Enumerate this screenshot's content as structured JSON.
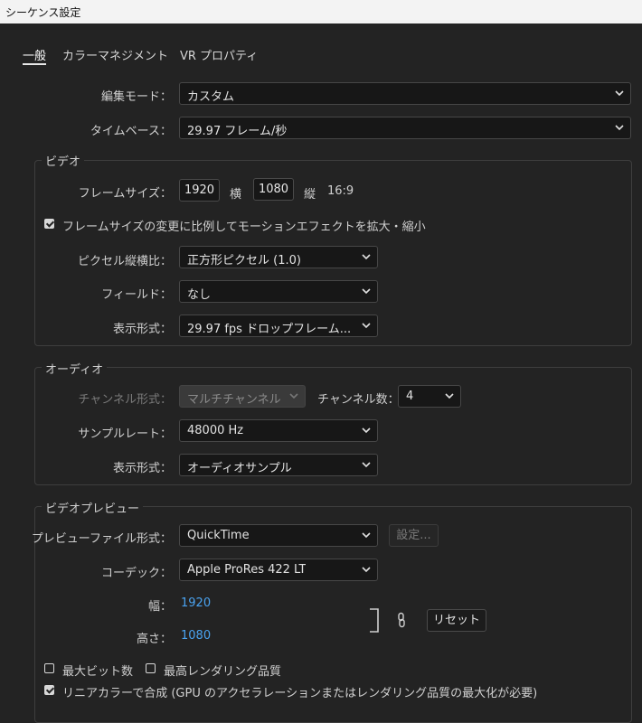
{
  "window": {
    "title": "シーケンス設定"
  },
  "tabs": [
    {
      "label": "一般",
      "active": true
    },
    {
      "label": "カラーマネジメント",
      "active": false
    },
    {
      "label": "VR プロパティ",
      "active": false
    }
  ],
  "general": {
    "edit_mode": {
      "label": "編集モード：",
      "value": "カスタム"
    },
    "timebase": {
      "label": "タイムベース：",
      "value": "29.97  フレーム/秒"
    }
  },
  "video": {
    "title": "ビデオ",
    "frame_size": {
      "label": "フレームサイズ：",
      "width": "1920",
      "width_unit": "横",
      "height": "1080",
      "height_unit": "縦",
      "ratio": "16:9"
    },
    "scale_checkbox": {
      "label": "フレームサイズの変更に比例してモーションエフェクトを拡大・縮小",
      "checked": true
    },
    "pixel_aspect": {
      "label": "ピクセル縦横比：",
      "value": "正方形ピクセル (1.0)"
    },
    "fields": {
      "label": "フィールド：",
      "value": "なし"
    },
    "display_format": {
      "label": "表示形式：",
      "value": "29.97 fps ドロップフレーム..."
    }
  },
  "audio": {
    "title": "オーディオ",
    "channel_format": {
      "label": "チャンネル形式：",
      "value": "マルチチャンネル"
    },
    "channel_count": {
      "label": "チャンネル数：",
      "value": "4"
    },
    "sample_rate": {
      "label": "サンプルレート：",
      "value": "48000 Hz"
    },
    "display_format": {
      "label": "表示形式：",
      "value": "オーディオサンプル"
    }
  },
  "preview": {
    "title": "ビデオプレビュー",
    "file_format": {
      "label": "プレビューファイル形式：",
      "value": "QuickTime",
      "settings_label": "設定..."
    },
    "codec": {
      "label": "コーデック：",
      "value": "Apple ProRes 422 LT"
    },
    "width": {
      "label": "幅：",
      "value": "1920"
    },
    "height": {
      "label": "高さ：",
      "value": "1080"
    },
    "reset_label": "リセット"
  },
  "options": {
    "max_bit_depth": {
      "label": "最大ビット数",
      "checked": false
    },
    "max_render_quality": {
      "label": "最高レンダリング品質",
      "checked": false
    },
    "linear_color": {
      "label": "リニアカラーで合成 (GPU のアクセラレーションまたはレンダリング品質の最大化が必要)",
      "checked": true
    }
  },
  "icons": {
    "chevron": "chevron-down-icon",
    "link": "link-icon",
    "bracket": "bracket-icon"
  }
}
